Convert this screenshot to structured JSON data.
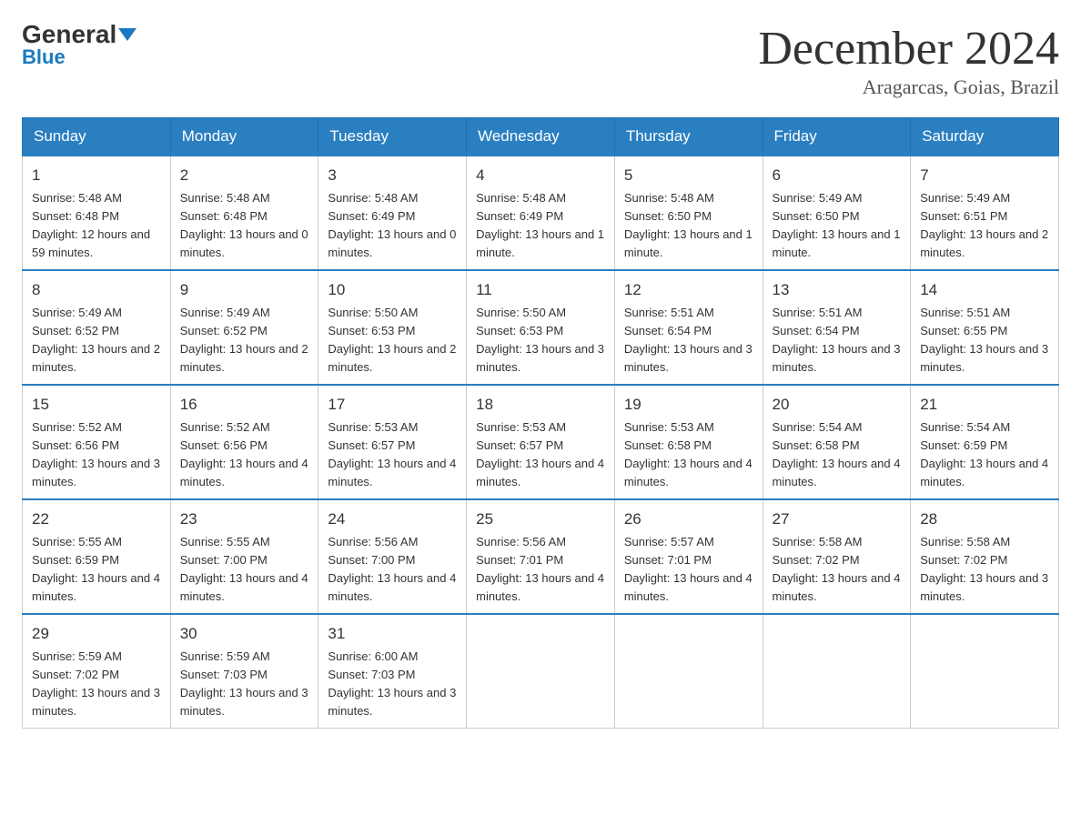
{
  "logo": {
    "general": "General",
    "triangle": "▶",
    "blue": "Blue"
  },
  "header": {
    "month": "December 2024",
    "location": "Aragarcas, Goias, Brazil"
  },
  "days_of_week": [
    "Sunday",
    "Monday",
    "Tuesday",
    "Wednesday",
    "Thursday",
    "Friday",
    "Saturday"
  ],
  "weeks": [
    [
      {
        "day": "1",
        "sunrise": "5:48 AM",
        "sunset": "6:48 PM",
        "daylight": "12 hours and 59 minutes."
      },
      {
        "day": "2",
        "sunrise": "5:48 AM",
        "sunset": "6:48 PM",
        "daylight": "13 hours and 0 minutes."
      },
      {
        "day": "3",
        "sunrise": "5:48 AM",
        "sunset": "6:49 PM",
        "daylight": "13 hours and 0 minutes."
      },
      {
        "day": "4",
        "sunrise": "5:48 AM",
        "sunset": "6:49 PM",
        "daylight": "13 hours and 1 minute."
      },
      {
        "day": "5",
        "sunrise": "5:48 AM",
        "sunset": "6:50 PM",
        "daylight": "13 hours and 1 minute."
      },
      {
        "day": "6",
        "sunrise": "5:49 AM",
        "sunset": "6:50 PM",
        "daylight": "13 hours and 1 minute."
      },
      {
        "day": "7",
        "sunrise": "5:49 AM",
        "sunset": "6:51 PM",
        "daylight": "13 hours and 2 minutes."
      }
    ],
    [
      {
        "day": "8",
        "sunrise": "5:49 AM",
        "sunset": "6:52 PM",
        "daylight": "13 hours and 2 minutes."
      },
      {
        "day": "9",
        "sunrise": "5:49 AM",
        "sunset": "6:52 PM",
        "daylight": "13 hours and 2 minutes."
      },
      {
        "day": "10",
        "sunrise": "5:50 AM",
        "sunset": "6:53 PM",
        "daylight": "13 hours and 2 minutes."
      },
      {
        "day": "11",
        "sunrise": "5:50 AM",
        "sunset": "6:53 PM",
        "daylight": "13 hours and 3 minutes."
      },
      {
        "day": "12",
        "sunrise": "5:51 AM",
        "sunset": "6:54 PM",
        "daylight": "13 hours and 3 minutes."
      },
      {
        "day": "13",
        "sunrise": "5:51 AM",
        "sunset": "6:54 PM",
        "daylight": "13 hours and 3 minutes."
      },
      {
        "day": "14",
        "sunrise": "5:51 AM",
        "sunset": "6:55 PM",
        "daylight": "13 hours and 3 minutes."
      }
    ],
    [
      {
        "day": "15",
        "sunrise": "5:52 AM",
        "sunset": "6:56 PM",
        "daylight": "13 hours and 3 minutes."
      },
      {
        "day": "16",
        "sunrise": "5:52 AM",
        "sunset": "6:56 PM",
        "daylight": "13 hours and 4 minutes."
      },
      {
        "day": "17",
        "sunrise": "5:53 AM",
        "sunset": "6:57 PM",
        "daylight": "13 hours and 4 minutes."
      },
      {
        "day": "18",
        "sunrise": "5:53 AM",
        "sunset": "6:57 PM",
        "daylight": "13 hours and 4 minutes."
      },
      {
        "day": "19",
        "sunrise": "5:53 AM",
        "sunset": "6:58 PM",
        "daylight": "13 hours and 4 minutes."
      },
      {
        "day": "20",
        "sunrise": "5:54 AM",
        "sunset": "6:58 PM",
        "daylight": "13 hours and 4 minutes."
      },
      {
        "day": "21",
        "sunrise": "5:54 AM",
        "sunset": "6:59 PM",
        "daylight": "13 hours and 4 minutes."
      }
    ],
    [
      {
        "day": "22",
        "sunrise": "5:55 AM",
        "sunset": "6:59 PM",
        "daylight": "13 hours and 4 minutes."
      },
      {
        "day": "23",
        "sunrise": "5:55 AM",
        "sunset": "7:00 PM",
        "daylight": "13 hours and 4 minutes."
      },
      {
        "day": "24",
        "sunrise": "5:56 AM",
        "sunset": "7:00 PM",
        "daylight": "13 hours and 4 minutes."
      },
      {
        "day": "25",
        "sunrise": "5:56 AM",
        "sunset": "7:01 PM",
        "daylight": "13 hours and 4 minutes."
      },
      {
        "day": "26",
        "sunrise": "5:57 AM",
        "sunset": "7:01 PM",
        "daylight": "13 hours and 4 minutes."
      },
      {
        "day": "27",
        "sunrise": "5:58 AM",
        "sunset": "7:02 PM",
        "daylight": "13 hours and 4 minutes."
      },
      {
        "day": "28",
        "sunrise": "5:58 AM",
        "sunset": "7:02 PM",
        "daylight": "13 hours and 3 minutes."
      }
    ],
    [
      {
        "day": "29",
        "sunrise": "5:59 AM",
        "sunset": "7:02 PM",
        "daylight": "13 hours and 3 minutes."
      },
      {
        "day": "30",
        "sunrise": "5:59 AM",
        "sunset": "7:03 PM",
        "daylight": "13 hours and 3 minutes."
      },
      {
        "day": "31",
        "sunrise": "6:00 AM",
        "sunset": "7:03 PM",
        "daylight": "13 hours and 3 minutes."
      },
      null,
      null,
      null,
      null
    ]
  ]
}
